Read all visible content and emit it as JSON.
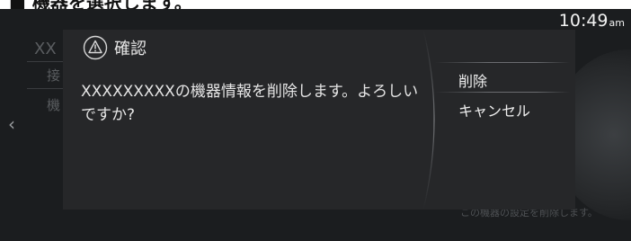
{
  "caption": "■ 機器を選択します。",
  "status_bar": {
    "time": "10:49",
    "ampm": "am"
  },
  "background": {
    "title": "XX",
    "items": [
      "接",
      "機"
    ],
    "footer": "この機器の設定を削除します。"
  },
  "dialog": {
    "title": "確認",
    "message": "XXXXXXXXXの機器情報を削除します。よろしいですか?",
    "options": {
      "delete": "削除",
      "cancel": "キャンセル"
    }
  }
}
